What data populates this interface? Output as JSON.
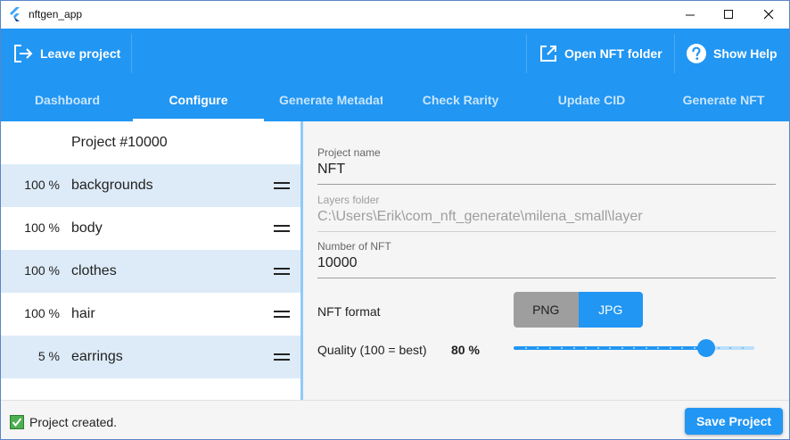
{
  "window": {
    "title": "nftgen_app"
  },
  "toolbar": {
    "leave_label": "Leave project",
    "open_folder_label": "Open NFT folder",
    "help_label": "Show Help"
  },
  "tabs": [
    {
      "label": "Dashboard"
    },
    {
      "label": "Configure",
      "active": true
    },
    {
      "label": "Generate Metadata"
    },
    {
      "label": "Check Rarity"
    },
    {
      "label": "Update CID"
    },
    {
      "label": "Generate NFT"
    }
  ],
  "project": {
    "title": "Project #10000",
    "layers": [
      {
        "percent": "100 %",
        "name": "backgrounds"
      },
      {
        "percent": "100 %",
        "name": "body"
      },
      {
        "percent": "100 %",
        "name": "clothes"
      },
      {
        "percent": "100 %",
        "name": "hair"
      },
      {
        "percent": "5 %",
        "name": "earrings"
      }
    ]
  },
  "form": {
    "project_name": {
      "label": "Project name",
      "value": "NFT"
    },
    "layers_folder": {
      "label": "Layers folder",
      "value": "C:\\Users\\Erik\\com_nft_generate\\milena_small\\layer"
    },
    "number_of_nft": {
      "label": "Number of NFT",
      "value": "10000"
    },
    "format": {
      "label": "NFT format",
      "options": [
        "PNG",
        "JPG"
      ],
      "selected": "JPG"
    },
    "quality": {
      "label": "Quality (100 = best)",
      "value_text": "80 %",
      "value": 80,
      "min": 0,
      "max": 100
    }
  },
  "status": {
    "message": "Project created.",
    "save_label": "Save Project"
  },
  "colors": {
    "primary": "#2196f3",
    "row_shade": "#ddebf8",
    "success": "#4caf50"
  }
}
